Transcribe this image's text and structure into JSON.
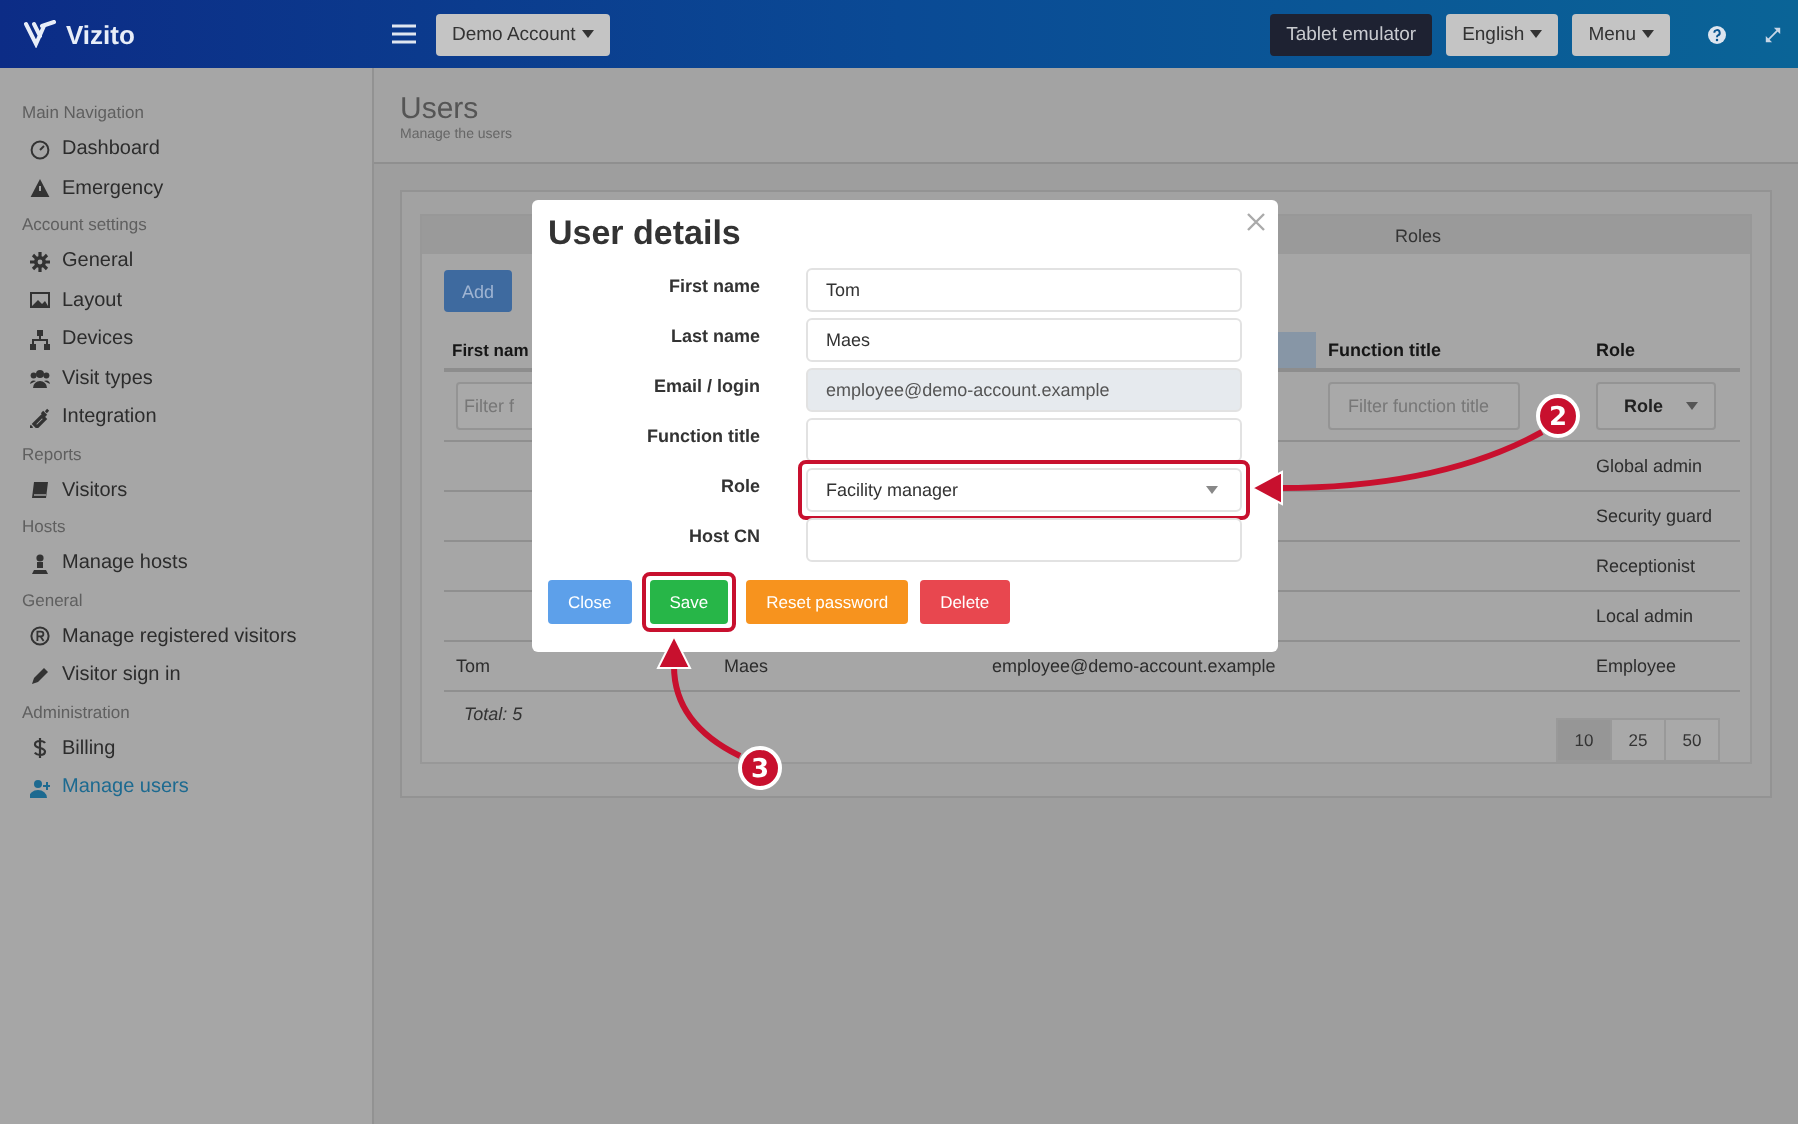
{
  "topbar": {
    "logo": "Vizito",
    "account": "Demo Account",
    "buttons": [
      {
        "label": "Tablet emulator",
        "kind": "dark"
      },
      {
        "label": "English",
        "kind": "dropdown"
      },
      {
        "label": "Menu",
        "kind": "dropdown"
      }
    ]
  },
  "sidebar": {
    "sections": [
      {
        "title": "Main Navigation",
        "items": [
          {
            "label": "Dashboard",
            "selected": false
          },
          {
            "label": "Emergency",
            "selected": false
          }
        ]
      },
      {
        "title": "Account settings",
        "items": [
          {
            "label": "General",
            "selected": false
          },
          {
            "label": "Layout",
            "selected": false
          },
          {
            "label": "Devices",
            "selected": false
          },
          {
            "label": "Visit types",
            "selected": false
          },
          {
            "label": "Integration",
            "selected": false
          }
        ]
      },
      {
        "title": "Reports",
        "items": [
          {
            "label": "Visitors",
            "selected": false
          }
        ]
      },
      {
        "title": "Hosts",
        "items": [
          {
            "label": "Manage hosts",
            "selected": false
          }
        ]
      },
      {
        "title": "General",
        "items": [
          {
            "label": "Manage registered visitors",
            "selected": false
          },
          {
            "label": "Visitor sign in",
            "selected": false
          }
        ]
      },
      {
        "title": "Administration",
        "items": [
          {
            "label": "Billing",
            "selected": false
          },
          {
            "label": "Manage users",
            "selected": true
          }
        ]
      }
    ]
  },
  "page": {
    "title": "Users",
    "subtitle": "Manage the users"
  },
  "tabs": [
    {
      "label": "Roles",
      "selected": false
    }
  ],
  "add_button": "Add",
  "table": {
    "columns": [
      {
        "label": "First nam",
        "sorted": false
      },
      {
        "sorted": true
      },
      {
        "label": "Function title",
        "sorted": false
      },
      {
        "label": "Role",
        "sorted": false
      }
    ],
    "filters": {
      "first_name": {
        "placeholder": "Filter f"
      },
      "function_title": {
        "placeholder": "Filter function title"
      },
      "role": {
        "value": "Role"
      }
    },
    "rows": [
      {
        "role": "Global admin"
      },
      {
        "role": "Security guard"
      },
      {
        "role": "Receptionist"
      },
      {
        "role": "Local admin"
      },
      {
        "first_name": "Tom",
        "last_name": "Maes",
        "email": "employee@demo-account.example",
        "role": "Employee"
      }
    ],
    "total": "Total: 5",
    "page_sizes": [
      {
        "label": "10",
        "selected": true
      },
      {
        "label": "25",
        "selected": false
      },
      {
        "label": "50",
        "selected": false
      }
    ]
  },
  "modal": {
    "title": "User details",
    "fields": [
      {
        "label": "First name",
        "kind": "text",
        "value": "Tom",
        "disabled": false,
        "highlighted": false
      },
      {
        "label": "Last name",
        "kind": "text",
        "value": "Maes",
        "disabled": false,
        "highlighted": false
      },
      {
        "label": "Email / login",
        "kind": "text",
        "value": "employee@demo-account.example",
        "disabled": true,
        "highlighted": false
      },
      {
        "label": "Function title",
        "kind": "text",
        "disabled": false,
        "highlighted": false
      },
      {
        "label": "Role",
        "kind": "select",
        "value": "Facility manager",
        "disabled": false,
        "highlighted": true
      },
      {
        "label": "Host CN",
        "kind": "text",
        "disabled": false,
        "highlighted": false
      }
    ],
    "buttons": [
      {
        "label": "Close",
        "kind": "info",
        "highlighted": false
      },
      {
        "label": "Save",
        "kind": "success",
        "highlighted": true
      },
      {
        "label": "Reset password",
        "kind": "warning",
        "highlighted": false
      },
      {
        "label": "Delete",
        "kind": "danger",
        "highlighted": false
      }
    ]
  },
  "annotations": [
    {
      "label": "2"
    },
    {
      "label": "3"
    }
  ]
}
